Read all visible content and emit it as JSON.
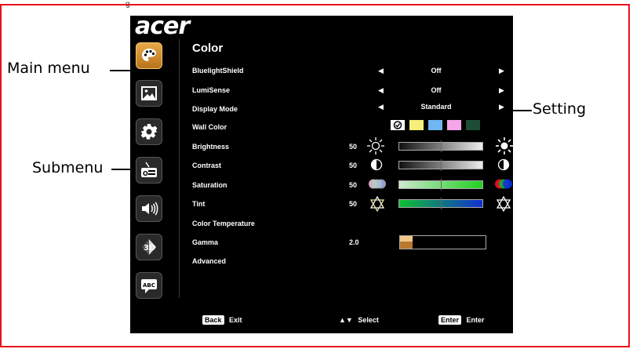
{
  "top_caption": "g",
  "brand": "acer",
  "panel_title": "Color",
  "rows": [
    {
      "label": "BluelightShield",
      "value": "Off"
    },
    {
      "label": "LumiSense",
      "value": "Off"
    },
    {
      "label": "Display Mode",
      "value": "Standard"
    },
    {
      "label": "Wall Color"
    },
    {
      "label": "Brightness",
      "value": "50"
    },
    {
      "label": "Contrast",
      "value": "50"
    },
    {
      "label": "Saturation",
      "value": "50"
    },
    {
      "label": "Tint",
      "value": "50"
    },
    {
      "label": "Color Temperature"
    },
    {
      "label": "Gamma",
      "value": "2.0"
    },
    {
      "label": "Advanced"
    }
  ],
  "levels": {
    "brightness": 0.5,
    "contrast": 0.5,
    "saturation": 0.5,
    "tint": 0.5,
    "gamma": 0.15
  },
  "wall_colors": [
    "#ffffff",
    "#f6ef7a",
    "#6fb6f2",
    "#f6a6e8",
    "#1d4d36"
  ],
  "menu_icons": [
    "palette-icon",
    "picture-icon",
    "gear-icon",
    "osd-settings-icon",
    "audio-icon",
    "3d-icon",
    "language-icon"
  ],
  "footer": {
    "back_key": "Back",
    "back_label": "Exit",
    "select_label": "Select",
    "enter_key": "Enter",
    "enter_label": "Enter"
  },
  "callouts": {
    "main_menu": "Main menu",
    "submenu": "Submenu",
    "setting": "Setting"
  },
  "colors": {
    "frame": "#e8121a",
    "active_icon": "#d98f2c"
  }
}
